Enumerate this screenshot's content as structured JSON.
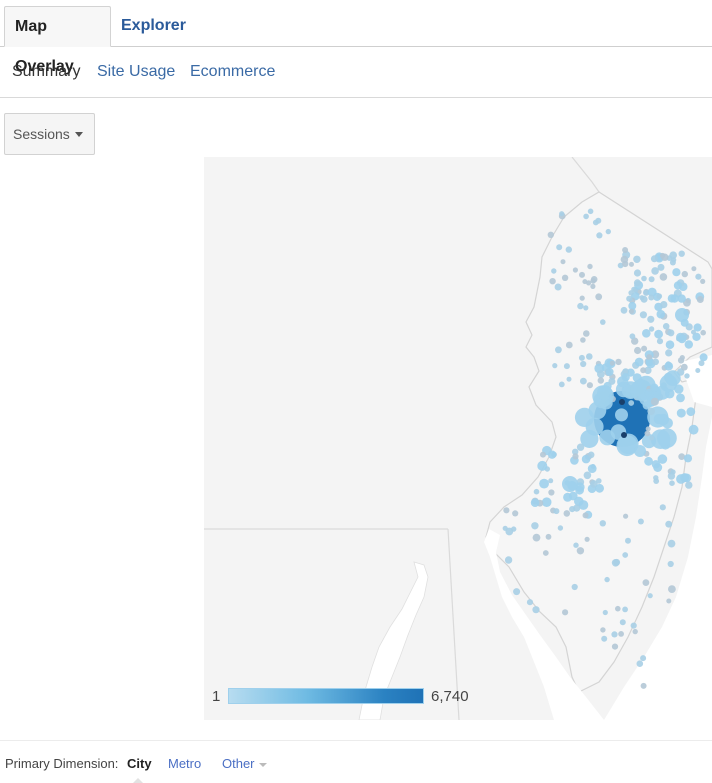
{
  "tabs": [
    {
      "label": "Map Overlay",
      "active": true
    },
    {
      "label": "Explorer",
      "active": false
    }
  ],
  "subtabs": [
    {
      "label": "Summary",
      "active": true
    },
    {
      "label": "Site Usage",
      "active": false
    },
    {
      "label": "Ecommerce",
      "active": false
    }
  ],
  "metric_selector": {
    "value": "Sessions"
  },
  "map": {
    "region": "New Jersey",
    "metric": "Sessions",
    "colors": {
      "low": "#b7dcf0",
      "high": "#1f72b6",
      "land": "#f4f4f4",
      "water": "#ffffff",
      "border": "#d6d6d6",
      "dot_gray": "#b4c8d6"
    },
    "legend": {
      "min": "1",
      "max": "6,740"
    }
  },
  "primary_dimension": {
    "label": "Primary Dimension:",
    "options": [
      {
        "label": "City",
        "active": true
      },
      {
        "label": "Metro",
        "active": false
      },
      {
        "label": "Other",
        "active": false,
        "dropdown": true
      }
    ]
  }
}
